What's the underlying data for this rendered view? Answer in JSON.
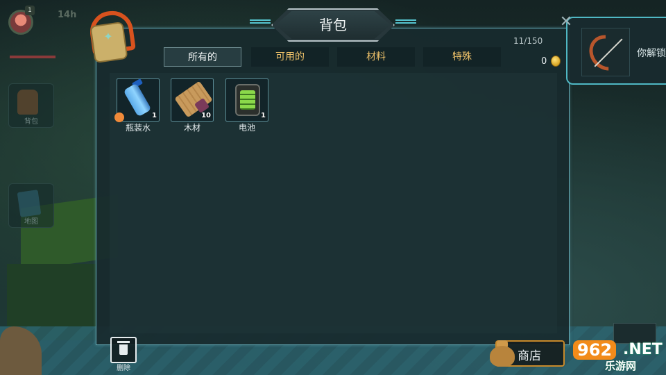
{
  "hud": {
    "level": "1",
    "time": "14h",
    "side_buttons": [
      "背包",
      "地图"
    ]
  },
  "panel": {
    "title": "背包",
    "capacity": "11/150",
    "gold": "0",
    "tabs": [
      {
        "label": "所有的",
        "active": true
      },
      {
        "label": "可用的",
        "active": false
      },
      {
        "label": "材料",
        "active": false
      },
      {
        "label": "特殊",
        "active": false
      }
    ],
    "items": [
      {
        "name": "瓶装水",
        "qty": "1",
        "icon": "water-bottle-icon"
      },
      {
        "name": "木材",
        "qty": "10",
        "icon": "wood-plank-icon"
      },
      {
        "name": "电池",
        "qty": "1",
        "icon": "battery-icon"
      }
    ]
  },
  "notification": {
    "text": "你解锁",
    "icon": "bow-icon"
  },
  "bottom": {
    "delete_label": "删除",
    "shop_label": "商店"
  },
  "watermark": {
    "num": "962",
    "net": ".NET",
    "sub": "乐游网"
  },
  "colors": {
    "panel_border": "#63a9b5",
    "tab_text": "#f0c36a",
    "shop_border": "#c8892a"
  }
}
